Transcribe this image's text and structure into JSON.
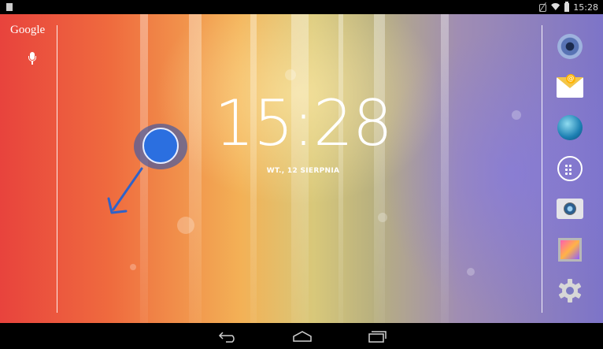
{
  "status_bar": {
    "time": "15:28"
  },
  "search": {
    "label": "Google"
  },
  "clock": {
    "time": "15:28",
    "date": "WT., 12 SIERPNIA"
  },
  "dock": {
    "icons": [
      "speaker-icon",
      "email-icon",
      "globe-icon",
      "apps-icon",
      "camera-icon",
      "gallery-icon",
      "settings-icon"
    ]
  },
  "nav_bar": {
    "icons": [
      "back-icon",
      "home-icon",
      "recent-apps-icon"
    ]
  },
  "colors": {
    "touch_indicator": "#2b6fe0",
    "arrow": "#2f62c8",
    "status_bar": "#000000"
  }
}
